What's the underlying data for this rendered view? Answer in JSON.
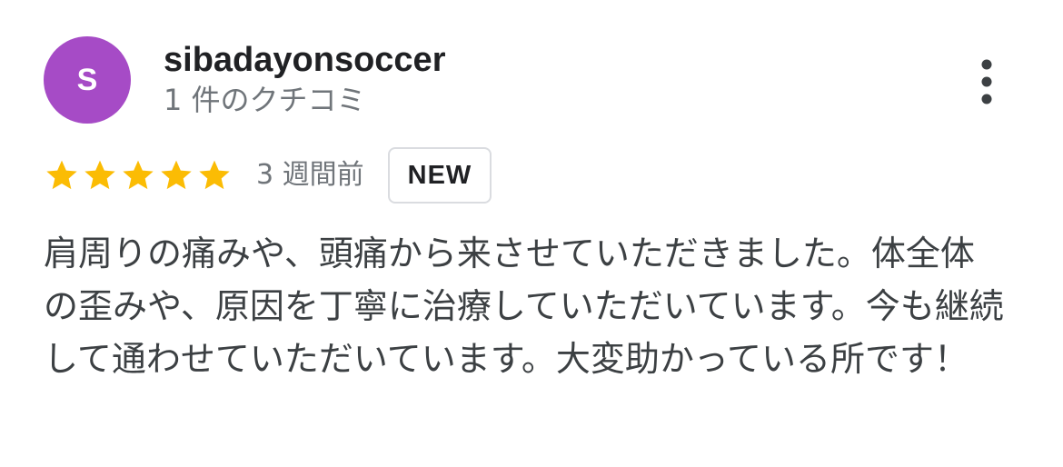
{
  "reviewer": {
    "avatar_initial": "S",
    "avatar_color": "#a64bc6",
    "name": "sibadayonsoccer",
    "review_count": "1 件のクチコミ"
  },
  "menu": {
    "icon": "more-vert-icon"
  },
  "rating": {
    "stars": 5,
    "max_stars": 5,
    "star_color": "#fbbc04",
    "timestamp": "3 週間前",
    "badge": "NEW"
  },
  "review": {
    "text": "肩周りの痛みや、頭痛から来させていただきました。体全体の歪みや、原因を丁寧に治療していただいています。今も継続して通わせていただいています。大変助かっている所です！"
  }
}
